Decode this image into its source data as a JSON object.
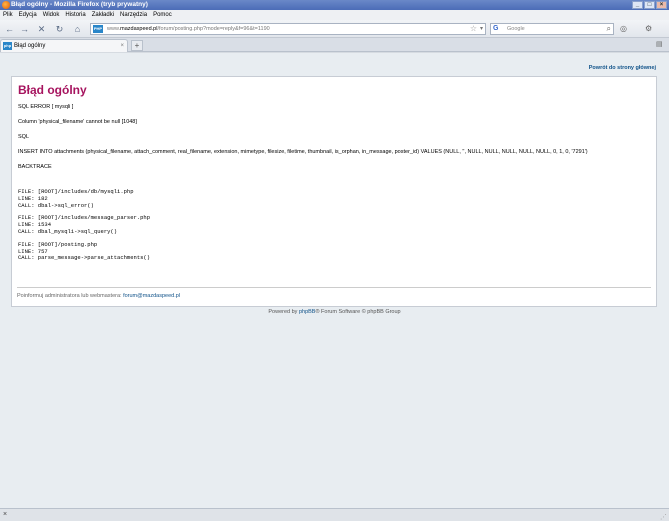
{
  "window": {
    "title": "Błąd ogólny - Mozilla Firefox (tryb prywatny)",
    "min": "_",
    "max": "□",
    "close": "×"
  },
  "menu": [
    "Plik",
    "Edycja",
    "Widok",
    "Historia",
    "Zakładki",
    "Narzędzia",
    "Pomoc"
  ],
  "nav": {
    "back": "←",
    "forward": "→",
    "stop": "✕",
    "reload": "↻",
    "home": "⌂",
    "url_prefix": "www.",
    "url_host": "mazdaspeed.pl",
    "url_path": "/forum/posting.php?mode=reply&f=96&t=1190",
    "site_icon": "PHP",
    "star": "☆",
    "search_engine": "G",
    "search_placeholder": "Google",
    "search_icon": "⌕"
  },
  "tab": {
    "label": "Błąd ogólny",
    "new_tab": "+"
  },
  "page": {
    "return_link": "Powrót do strony głównej",
    "title": "Błąd ogólny",
    "sql_error": "SQL ERROR [ mysqli ]",
    "column_msg": "Column 'physical_filename' cannot be null [1048]",
    "sql_label": "SQL",
    "sql_query": "INSERT INTO attachments (physical_filename, attach_comment, real_filename, extension, mimetype, filesize, filetime, thumbnail, is_orphan, in_message, poster_id) VALUES (NULL, '', NULL, NULL, NULL, NULL, NULL, 0, 1, 0, '7291')",
    "backtrace_label": "BACKTRACE",
    "backtrace": [
      {
        "file": "FILE: [ROOT]/includes/db/mysqli.php",
        "line": "LINE: 182",
        "call": "CALL: dbal->sql_error()"
      },
      {
        "file": "FILE: [ROOT]/includes/message_parser.php",
        "line": "LINE: 1534",
        "call": "CALL: dbal_mysqli->sql_query()"
      },
      {
        "file": "FILE: [ROOT]/posting.php",
        "line": "LINE: 757",
        "call": "CALL: parse_message->parse_attachments()"
      }
    ],
    "footnote_text": "Poinformuj administratora lub webmastera:",
    "footnote_email": "forum@mazdaspeed.pl",
    "powered_prefix": "Powered by",
    "powered_link": "phpBB",
    "powered_suffix": "® Forum Software © phpBB Group"
  },
  "status": {
    "close": "×"
  }
}
